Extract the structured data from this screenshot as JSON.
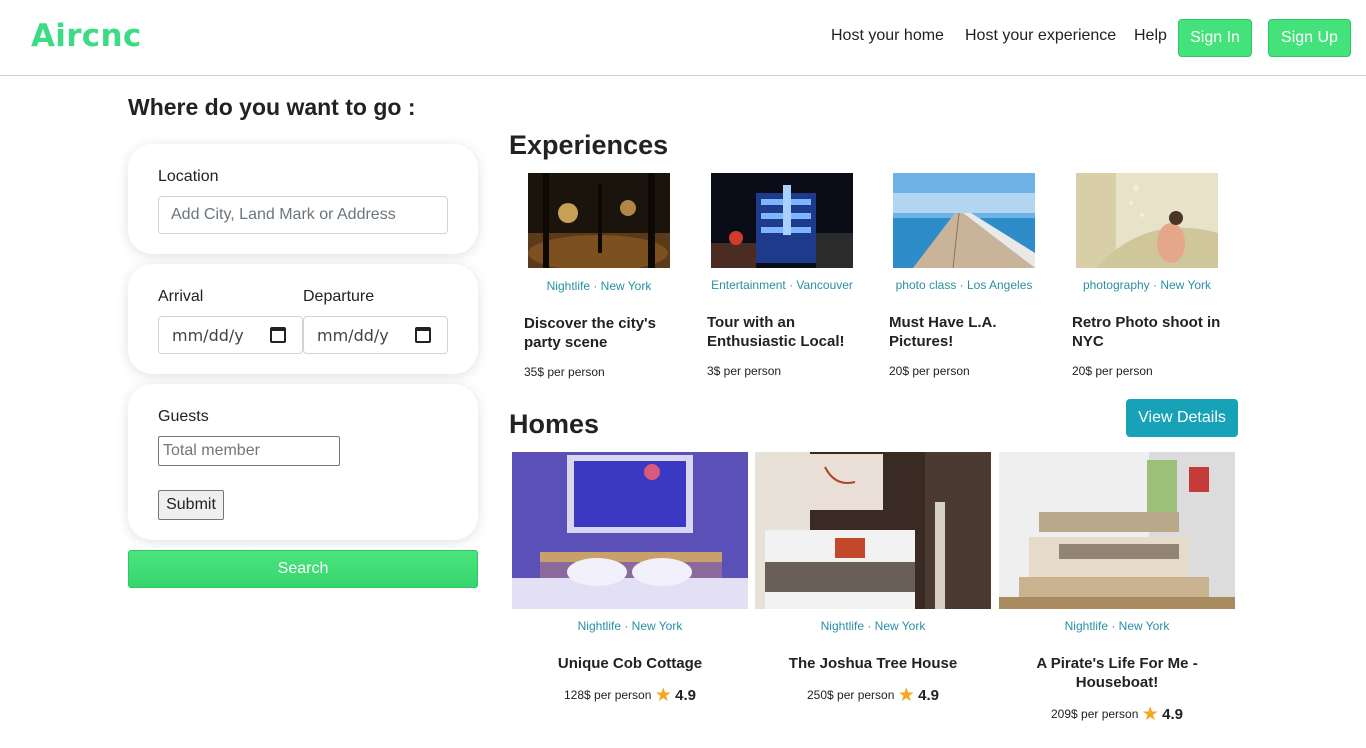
{
  "header": {
    "logo": "Aircnc",
    "nav": [
      "Host your home",
      "Host your experience",
      "Help"
    ],
    "sign_in": "Sign In",
    "sign_up": "Sign Up"
  },
  "search": {
    "title": "Where do you want to go :",
    "location_label": "Location",
    "location_placeholder": "Add City, Land Mark or Address",
    "arrival_label": "Arrival",
    "departure_label": "Departure",
    "date_placeholder": "mm/dd/y",
    "guests_label": "Guests",
    "guests_placeholder": "Total member",
    "submit_label": "Submit",
    "search_label": "Search"
  },
  "experiences": {
    "title": "Experiences",
    "items": [
      {
        "category": "Nightlife · New York",
        "title": "Discover the city's party scene",
        "price": "35$ per person"
      },
      {
        "category": "Entertainment · Vancouver",
        "title": "Tour with an Enthusiastic Local!",
        "price": "3$ per person"
      },
      {
        "category": "photo class · Los Angeles",
        "title": "Must Have L.A. Pictures!",
        "price": "20$ per person"
      },
      {
        "category": "photography · New York",
        "title": "Retro Photo shoot in NYC",
        "price": "20$ per person"
      }
    ]
  },
  "homes": {
    "title": "Homes",
    "view_details": "View Details",
    "items": [
      {
        "category": "Nightlife · New York",
        "title": "Unique Cob Cottage",
        "price": "128$ per person",
        "rating": "4.9"
      },
      {
        "category": "Nightlife · New York",
        "title": "The Joshua Tree House",
        "price": "250$ per person",
        "rating": "4.9"
      },
      {
        "category": "Nightlife · New York",
        "title": "A Pirate's Life For Me - Houseboat!",
        "price": "209$ per person",
        "rating": "4.9"
      }
    ]
  },
  "colors": {
    "brand_green": "#3ddc84",
    "accent_teal": "#17a2b8",
    "category_text": "#2a8fa6",
    "star": "#f5a623"
  },
  "icons": {
    "calendar": "calendar-icon",
    "star": "star-icon"
  }
}
